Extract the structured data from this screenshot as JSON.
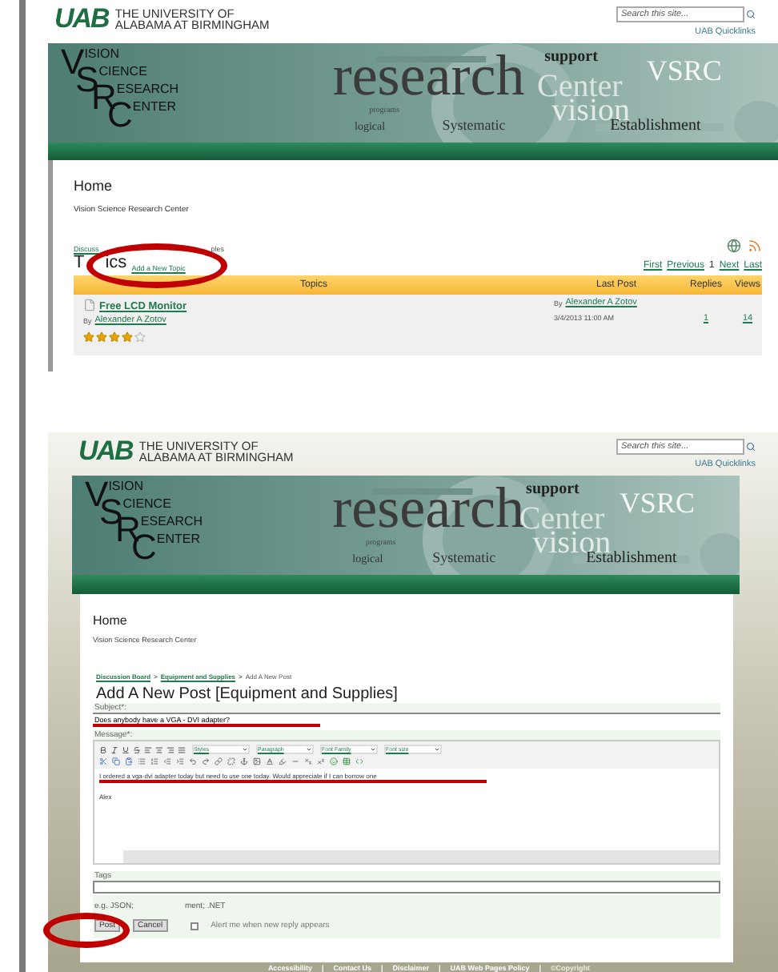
{
  "panels": [
    {
      "header": {
        "logo": "UAB",
        "university": [
          "THE UNIVERSITY OF",
          "ALABAMA AT BIRMINGHAM"
        ],
        "search_placeholder": "Search this site...",
        "quicklinks": "UAB Quicklinks"
      },
      "banner": {
        "logo_lines": [
          {
            "initial": "V",
            "rest": "ISION"
          },
          {
            "initial": "S",
            "rest": "CIENCE"
          },
          {
            "initial": "R",
            "rest": "ESEARCH"
          },
          {
            "initial": "C",
            "rest": "ENTER"
          }
        ],
        "words": [
          "research",
          "support",
          "VSRC",
          "Center",
          "programs",
          "vision",
          "logical",
          "Systematic",
          "Establishment"
        ]
      },
      "page_title": "Home",
      "site_name": "Vision Science Research Center",
      "breadcrumb_fragments": [
        "Discuss",
        "ples"
      ],
      "heading_fragments": [
        "T",
        "ics"
      ],
      "add_link": "Add a New Topic",
      "pager": [
        {
          "label": "First",
          "selected": false
        },
        {
          "label": "Previous",
          "selected": false
        },
        {
          "label": "1",
          "selected": true
        },
        {
          "label": "Next",
          "selected": false
        },
        {
          "label": "Last",
          "selected": false
        }
      ],
      "table": {
        "columns": [
          "Topics",
          "Last Post",
          "Replies",
          "Views"
        ],
        "rows": [
          {
            "title": "Free LCD Monitor",
            "by": "By",
            "author": "Alexander A Zotov",
            "stars": 4,
            "last_by": "By",
            "last_author": "Alexander A Zotov",
            "last_date": "3/4/2013 11:00 AM",
            "replies": "1",
            "views": "14"
          }
        ]
      }
    },
    {
      "header": {
        "logo": "UAB",
        "university": [
          "THE UNIVERSITY OF",
          "ALABAMA AT BIRMINGHAM"
        ],
        "search_placeholder": "Search this site...",
        "quicklinks": "UAB Quicklinks"
      },
      "banner": {
        "logo_lines": [
          {
            "initial": "V",
            "rest": "ISION"
          },
          {
            "initial": "S",
            "rest": "CIENCE"
          },
          {
            "initial": "R",
            "rest": "ESEARCH"
          },
          {
            "initial": "C",
            "rest": "ENTER"
          }
        ],
        "words": [
          "research",
          "support",
          "VSRC",
          "Center",
          "programs",
          "vision",
          "logical",
          "Systematic",
          "Establishment"
        ]
      },
      "page_title": "Home",
      "site_name": "Vision Science Research Center",
      "breadcrumb": [
        {
          "label": "Discussion Board",
          "kind": "link"
        },
        {
          "label": ">",
          "kind": "sep"
        },
        {
          "label": "Equipment and Supplies",
          "kind": "link"
        },
        {
          "label": ">",
          "kind": "sep"
        },
        {
          "label": "Add A New Post",
          "kind": "current"
        }
      ],
      "form": {
        "title": "Add A New Post [Equipment and Supplies]",
        "subject_label": "Subject*:",
        "subject_value": "Does anybody have a VGA - DVI adapter?",
        "message_label": "Message*:",
        "dropdowns": [
          "Styles",
          "Paragraph",
          "Font Family",
          "Font size"
        ],
        "message_lines": [
          "I ordered a vga-dvi adapter today but need to use one today. Would appreciate if I can borrow one",
          "Alex"
        ],
        "tags_label": "Tags",
        "tags_hint_fragments": [
          "e.g. JSON;",
          "ment; .NET"
        ],
        "buttons": [
          "Post",
          "Cancel"
        ],
        "alert": {
          "label": "Alert me when new reply appears",
          "checked": false
        }
      },
      "footer": [
        {
          "label": "Accessibility",
          "kind": "link"
        },
        {
          "label": "|",
          "kind": "sep"
        },
        {
          "label": "Contact Us",
          "kind": "link"
        },
        {
          "label": "|",
          "kind": "sep"
        },
        {
          "label": "Disclaimer",
          "kind": "link"
        },
        {
          "label": "|",
          "kind": "sep"
        },
        {
          "label": "UAB Web Pages Policy",
          "kind": "link"
        },
        {
          "label": "|",
          "kind": "sep"
        },
        {
          "label": "©Copyright",
          "kind": "text"
        }
      ]
    }
  ]
}
